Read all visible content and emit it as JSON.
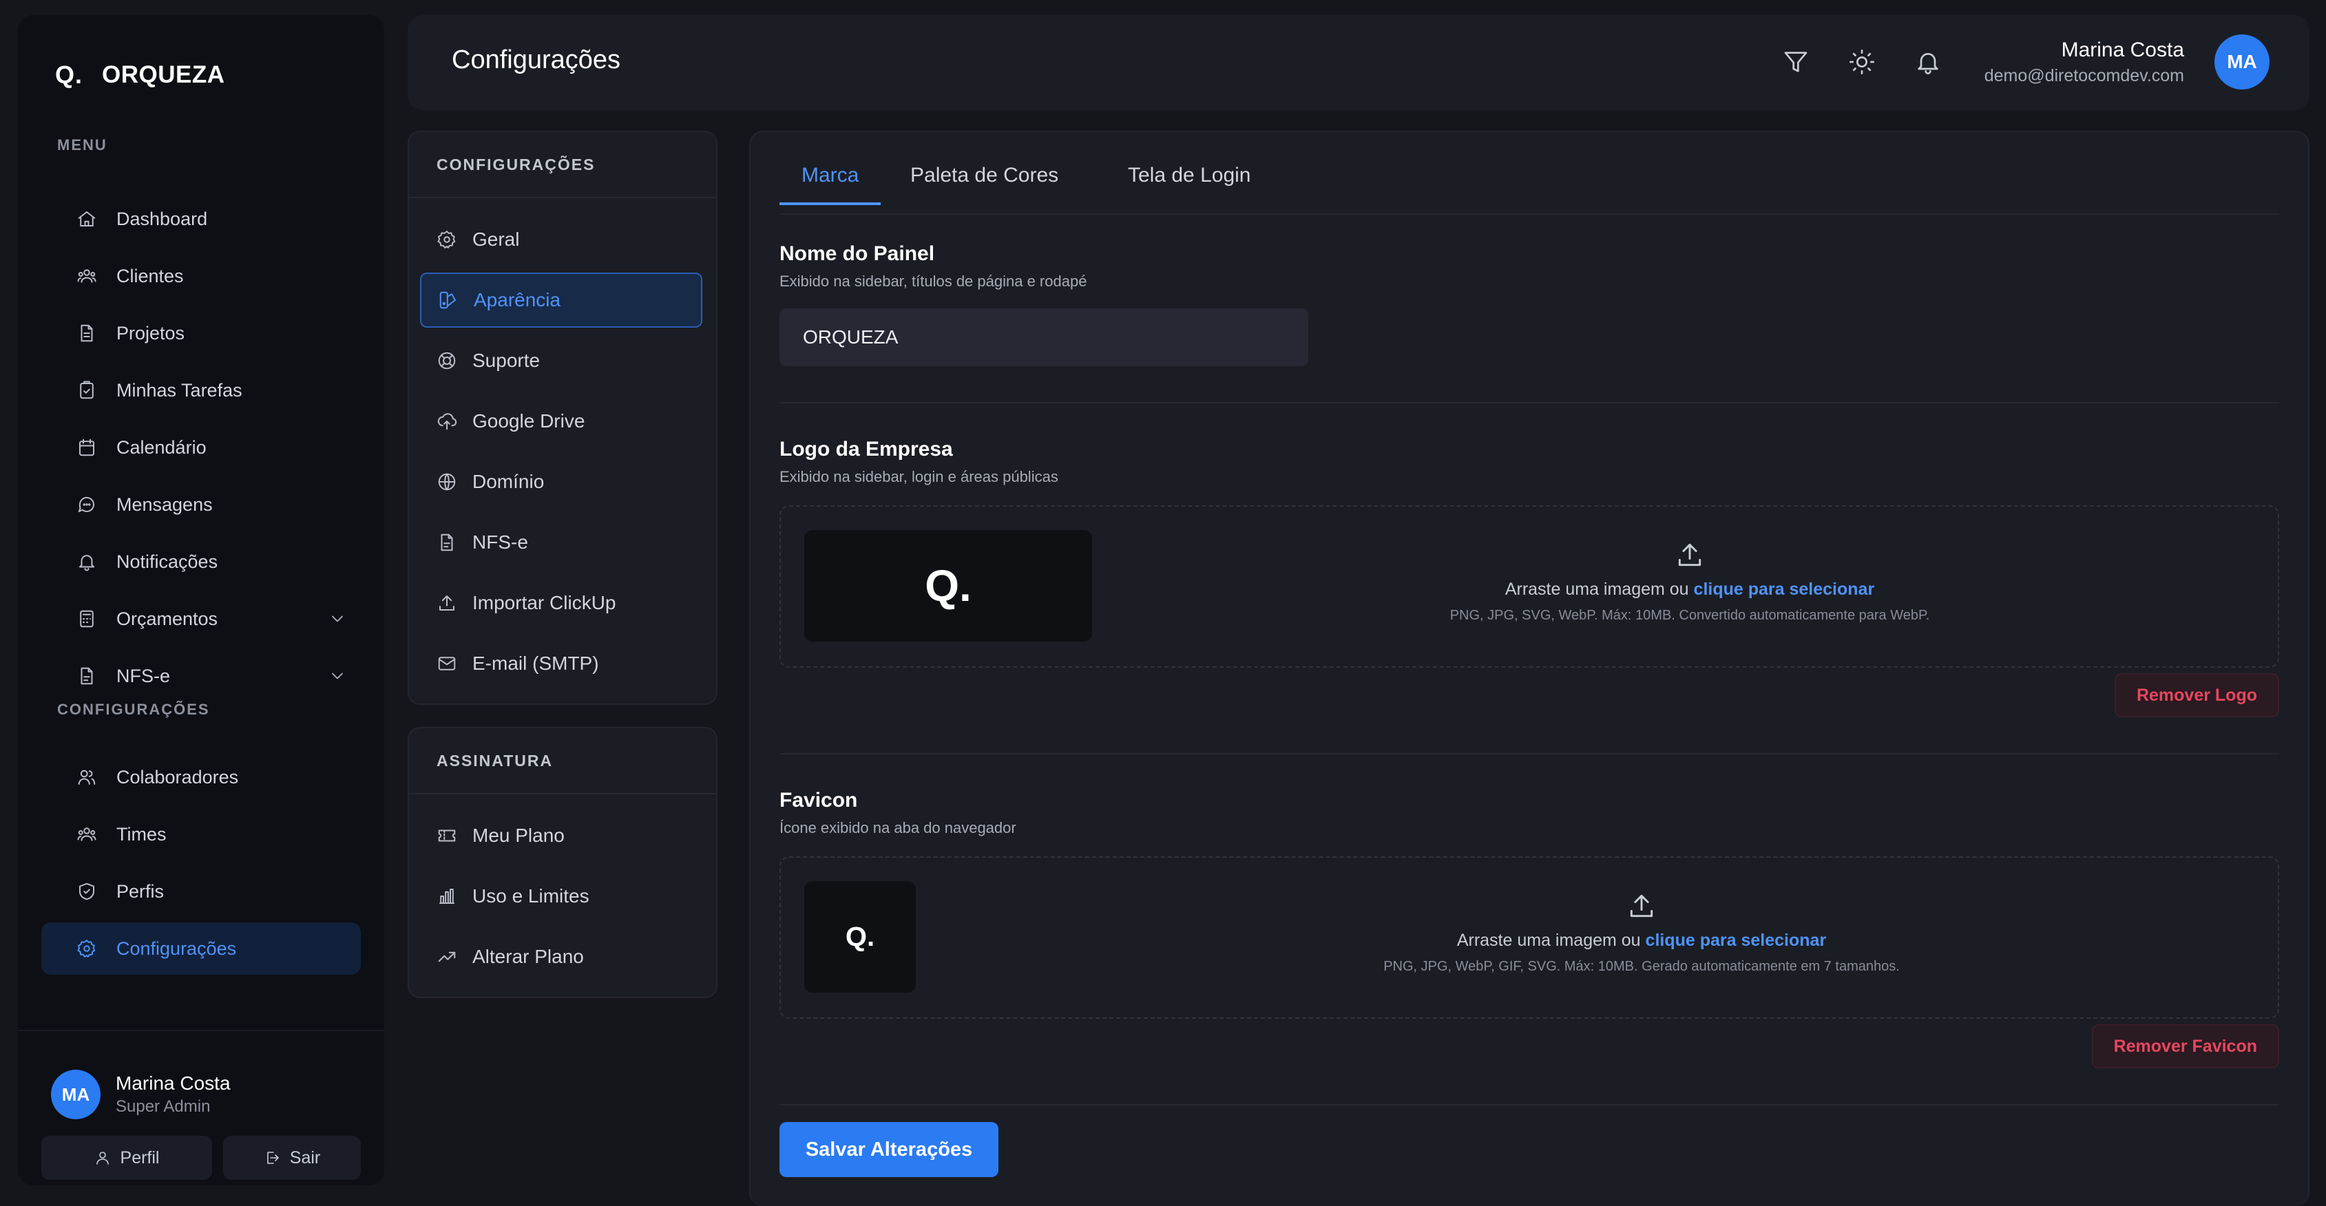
{
  "brand": {
    "mark": "Q.",
    "name": "ORQUEZA"
  },
  "sidebar": {
    "menu_title": "MENU",
    "items": [
      {
        "label": "Dashboard",
        "icon": "home-icon"
      },
      {
        "label": "Clientes",
        "icon": "users-icon"
      },
      {
        "label": "Projetos",
        "icon": "file-icon"
      },
      {
        "label": "Minhas Tarefas",
        "icon": "clipboard-check-icon"
      },
      {
        "label": "Calendário",
        "icon": "calendar-icon"
      },
      {
        "label": "Mensagens",
        "icon": "message-icon"
      },
      {
        "label": "Notificações",
        "icon": "bell-icon"
      },
      {
        "label": "Orçamentos",
        "icon": "calculator-icon",
        "expandable": true
      },
      {
        "label": "NFS-e",
        "icon": "receipt-icon",
        "expandable": true
      }
    ],
    "config_title": "CONFIGURAÇÕES",
    "config_items": [
      {
        "label": "Colaboradores",
        "icon": "user-group-icon"
      },
      {
        "label": "Times",
        "icon": "team-icon"
      },
      {
        "label": "Perfis",
        "icon": "shield-icon"
      },
      {
        "label": "Configurações",
        "icon": "gear-icon",
        "active": true
      }
    ],
    "user": {
      "initials": "MA",
      "name": "Marina Costa",
      "role": "Super Admin"
    },
    "profile_button": "Perfil",
    "logout_button": "Sair"
  },
  "header": {
    "title": "Configurações",
    "user": {
      "name": "Marina Costa",
      "email": "demo@diretocomdev.com",
      "initials": "MA"
    },
    "icons": [
      "filter-icon",
      "sun-icon",
      "bell-icon"
    ]
  },
  "settings_menu": {
    "title": "CONFIGURAÇÕES",
    "items": [
      {
        "label": "Geral",
        "icon": "gear-icon"
      },
      {
        "label": "Aparência",
        "icon": "palette-icon",
        "active": true
      },
      {
        "label": "Suporte",
        "icon": "lifebuoy-icon"
      },
      {
        "label": "Google Drive",
        "icon": "cloud-upload-icon"
      },
      {
        "label": "Domínio",
        "icon": "globe-icon"
      },
      {
        "label": "NFS-e",
        "icon": "file-icon"
      },
      {
        "label": "Importar ClickUp",
        "icon": "upload-icon"
      },
      {
        "label": "E-mail (SMTP)",
        "icon": "mail-icon"
      }
    ]
  },
  "subscription_menu": {
    "title": "ASSINATURA",
    "items": [
      {
        "label": "Meu Plano",
        "icon": "ticket-icon"
      },
      {
        "label": "Uso e Limites",
        "icon": "bar-chart-icon"
      },
      {
        "label": "Alterar Plano",
        "icon": "trending-up-icon"
      }
    ]
  },
  "main": {
    "tabs": [
      {
        "label": "Marca",
        "active": true
      },
      {
        "label": "Paleta de Cores"
      },
      {
        "label": "Tela de Login"
      }
    ],
    "panel_name": {
      "title": "Nome do Painel",
      "subtitle": "Exibido na sidebar, títulos de página e rodapé",
      "value": "ORQUEZA"
    },
    "logo": {
      "title": "Logo da Empresa",
      "subtitle": "Exibido na sidebar, login e áreas públicas",
      "preview_mark": "Q.",
      "drop_text": "Arraste uma imagem ou",
      "drop_link": "clique para selecionar",
      "hint": "PNG, JPG, SVG, WebP. Máx: 10MB. Convertido automaticamente para WebP.",
      "remove_button": "Remover Logo"
    },
    "favicon": {
      "title": "Favicon",
      "subtitle": "Ícone exibido na aba do navegador",
      "preview_mark": "Q.",
      "drop_text": "Arraste uma imagem ou",
      "drop_link": "clique para selecionar",
      "hint": "PNG, JPG, WebP, GIF, SVG. Máx: 10MB. Gerado automaticamente em 7 tamanhos.",
      "remove_button": "Remover Favicon"
    },
    "save_button": "Salvar Alterações"
  },
  "colors": {
    "accent": "#2b7bf2",
    "accent_text": "#4f93f7",
    "danger": "#e5485f",
    "background": "#15161b",
    "surface": "#1b1d24"
  }
}
